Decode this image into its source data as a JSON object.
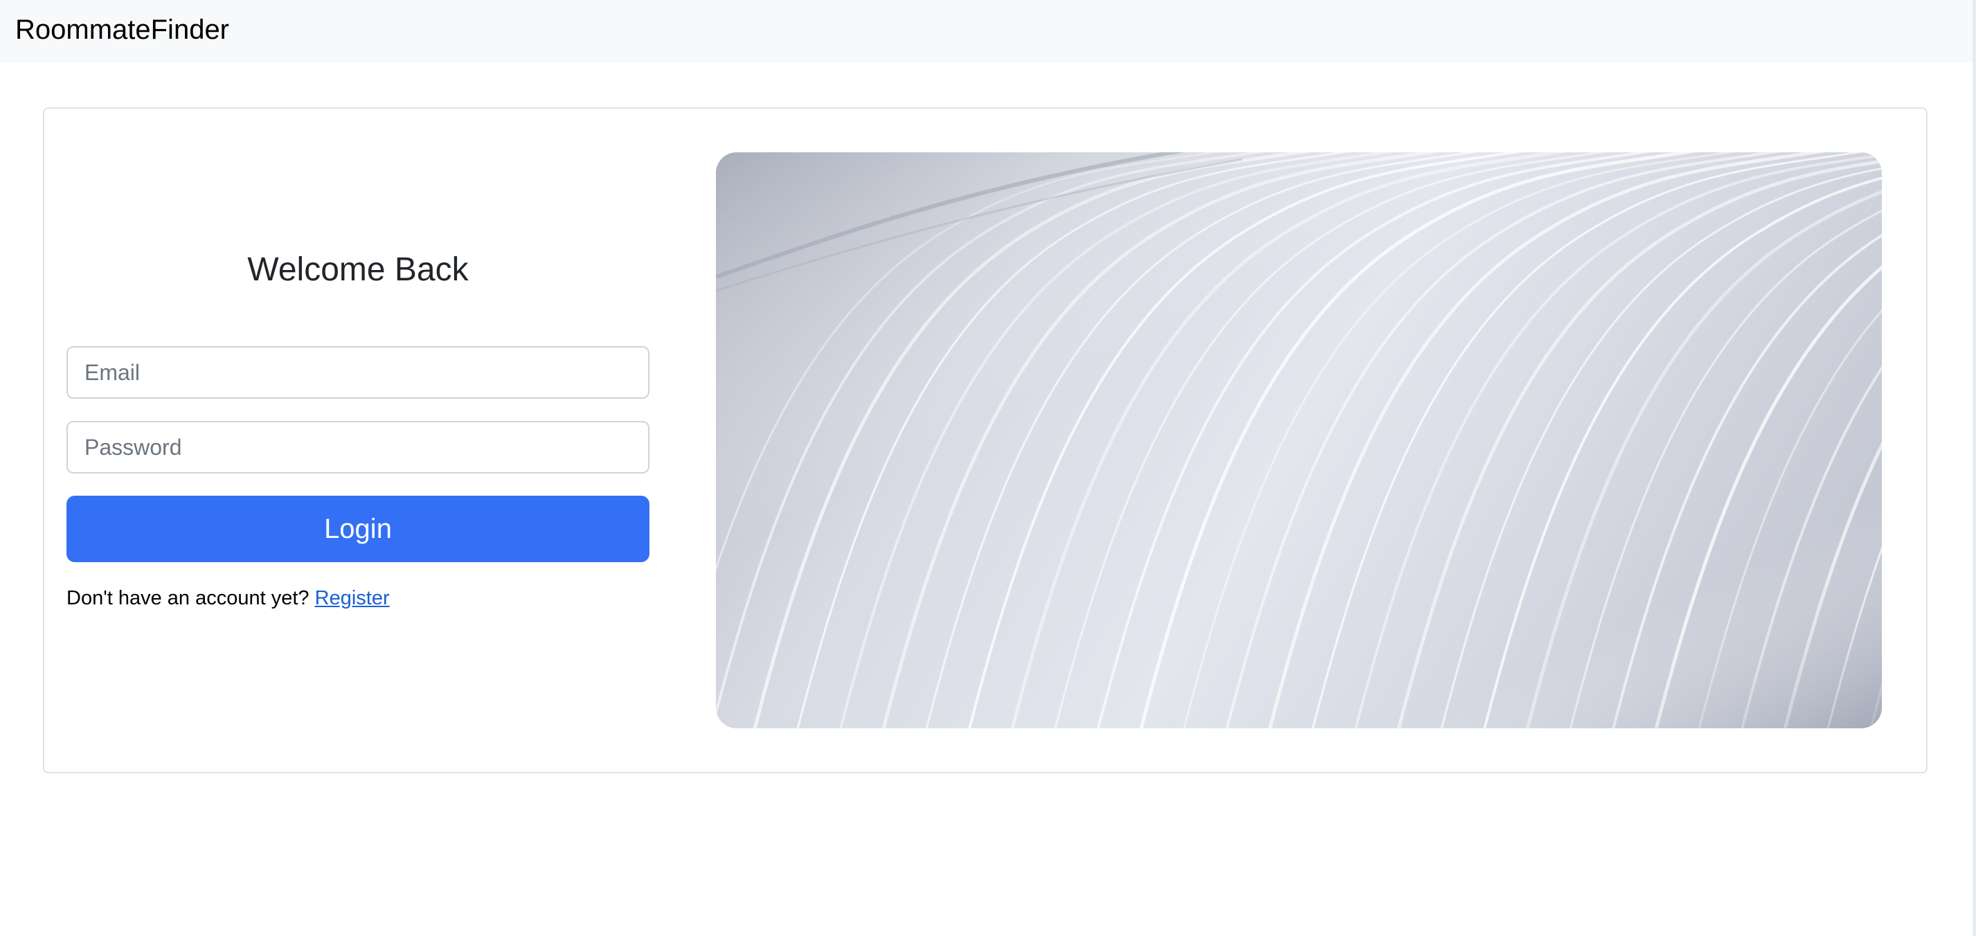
{
  "navbar": {
    "brand": "RoommateFinder"
  },
  "login": {
    "title": "Welcome Back",
    "email_placeholder": "Email",
    "password_placeholder": "Password",
    "submit_label": "Login",
    "register_prompt": "Don't have an account yet?",
    "register_link": "Register"
  },
  "hero": {
    "image_name": "abstract-wave-lines-image"
  },
  "colors": {
    "primary": "#3370f5",
    "link": "#1a5fd6",
    "navbar_bg": "#f8f9fa",
    "border": "#dee2e6"
  }
}
